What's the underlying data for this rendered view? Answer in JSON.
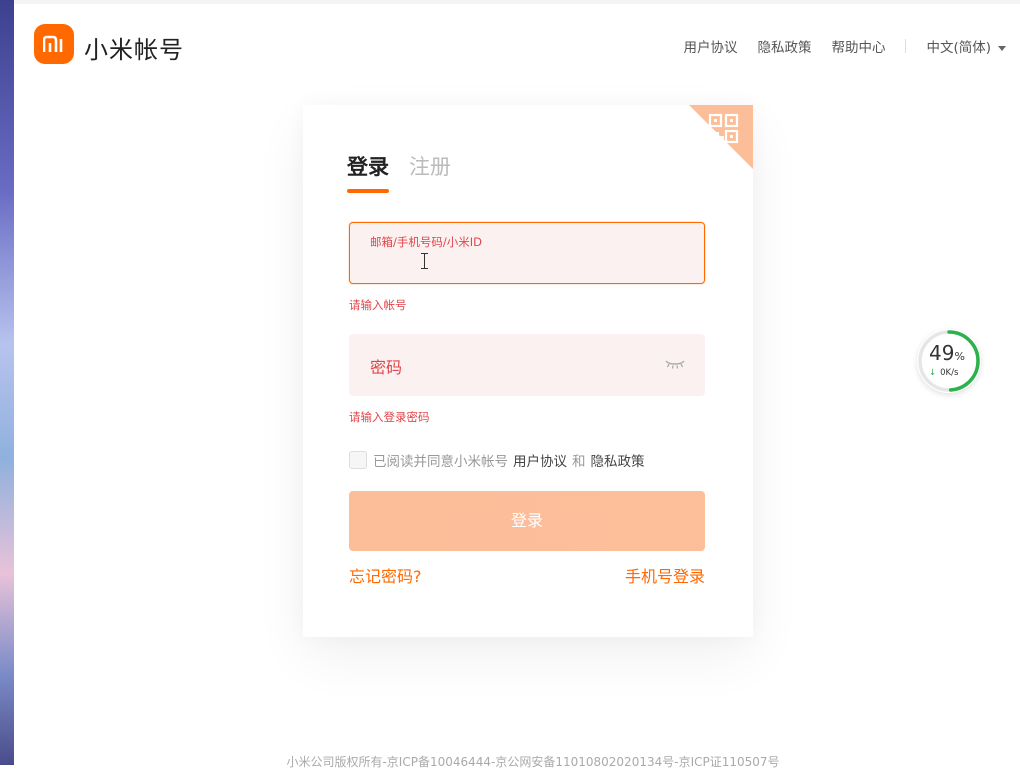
{
  "header": {
    "brand": "小米帐号",
    "nav": {
      "user_agreement": "用户协议",
      "privacy_policy": "隐私政策",
      "help_center": "帮助中心",
      "language": "中文(简体)"
    }
  },
  "login": {
    "tabs": {
      "login": "登录",
      "register": "注册"
    },
    "account_field": {
      "label": "邮箱/手机号码/小米ID",
      "error": "请输入帐号"
    },
    "password_field": {
      "placeholder": "密码",
      "error": "请输入登录密码"
    },
    "agreement": {
      "prefix": "已阅读并同意小米帐号",
      "user_agreement": "用户协议",
      "and": "和",
      "privacy_policy": "隐私政策"
    },
    "submit_label": "登录",
    "forgot_password": "忘记密码?",
    "phone_login": "手机号登录"
  },
  "speed_widget": {
    "percent": "49",
    "percent_unit": "%",
    "rate": "0K/s",
    "progress": 0.49
  },
  "footer": {
    "copyright": "小米公司版权所有-京ICP备10046444-京公网安备11010802020134号-京ICP证110507号"
  },
  "colors": {
    "accent": "#ff6900",
    "error": "#e0464a",
    "field_bg": "#fbf1f1"
  }
}
